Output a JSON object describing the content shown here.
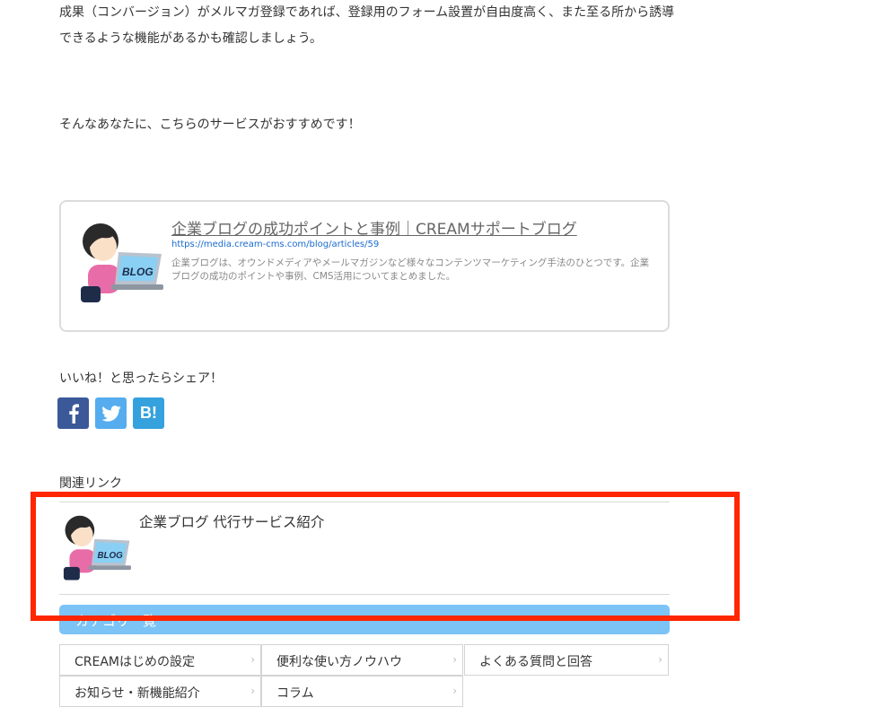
{
  "article": {
    "paragraph_1": "成果（コンバージョン）がメルマガ登録であれば、登録用のフォーム設置が自由度高く、また至る所から誘導できるような機能があるかも確認しましょう。",
    "paragraph_2": "そんなあなたに、こちらのサービスがおすすめです！"
  },
  "link_card": {
    "title": "企業ブログの成功ポイントと事例｜CREAMサポートブログ",
    "url": "https://media.cream-cms.com/blog/articles/59",
    "description": "企業ブログは、オウンドメディアやメールマガジンなど様々なコンテンツマーケティング手法のひとつです。企業ブログの成功のポイントや事例、CMS活用についてまとめました。",
    "thumb_text": "BLOG"
  },
  "share": {
    "heading": "いいね！と思ったらシェア！",
    "facebook_icon": "f",
    "twitter_icon": "twitter-bird",
    "hatena_label": "B!"
  },
  "related": {
    "heading": "関連リンク",
    "items": [
      {
        "title": "企業ブログ 代行サービス紹介",
        "thumb_text": "BLOG"
      }
    ]
  },
  "categories": {
    "heading": "カテゴリ一覧",
    "items": [
      {
        "label": "CREAMはじめの設定"
      },
      {
        "label": "便利な使い方ノウハウ"
      },
      {
        "label": "よくある質問と回答"
      },
      {
        "label": "お知らせ・新機能紹介"
      },
      {
        "label": "コラム"
      }
    ],
    "chevron": "›"
  },
  "colors": {
    "highlight": "#ff2600",
    "category_header": "#7cc3f6",
    "facebook": "#3b5998",
    "twitter": "#55acee",
    "hatena": "#35a1dd"
  }
}
